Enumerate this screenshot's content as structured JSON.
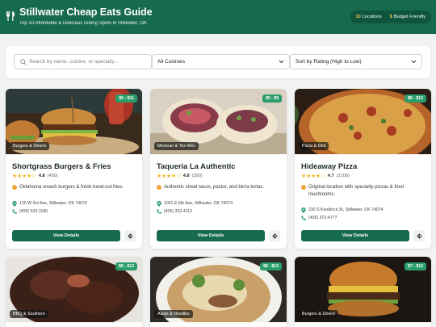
{
  "header": {
    "title": "Stillwater Cheap Eats Guide",
    "subtitle": "Top 10 Affordable & Delicious Dining Spots in Stillwater, OK",
    "stats": [
      {
        "value": "10",
        "label": "Locations"
      },
      {
        "value": "$",
        "label": "Budget Friendly"
      }
    ]
  },
  "filters": {
    "search_placeholder": "Search by name, cuisine, or specialty...",
    "cuisine_selected": "All Cuisines",
    "sort_selected": "Sort by Rating (High to Low)"
  },
  "restaurants": [
    {
      "name": "Shortgrass Burgers & Fries",
      "price": "$6 - $11",
      "category": "Burgers & Diners",
      "stars": "★★★★☆",
      "rating": "4.8",
      "reviews": "(450)",
      "specialty": "Oklahoma smash burgers & fresh hand-cut fries.",
      "address": "120 W 3rd Ave, Stillwater, OK 74074",
      "phone": "(405) 533-1180",
      "button": "View Details"
    },
    {
      "name": "Taqueria La Authentic",
      "price": "$5 - $9",
      "category": "Mexican & Tex-Mex",
      "stars": "★★★★☆",
      "rating": "4.8",
      "reviews": "(390)",
      "specialty": "Authentic street tacos, pastor, and birria tortas.",
      "address": "1001 E 6th Ave, Stillwater, OK 74074",
      "phone": "(405) 332-4112",
      "button": "View Details"
    },
    {
      "name": "Hideaway Pizza",
      "price": "$8 - $13",
      "category": "Pizza & Deli",
      "stars": "★★★★☆",
      "rating": "4.7",
      "reviews": "(2100)",
      "specialty": "Original location with specialty pizzas & fried mushrooms.",
      "address": "230 S Knoblock St, Stillwater, OK 74074",
      "phone": "(405) 372-4777",
      "button": "View Details"
    },
    {
      "price": "$8 - $13",
      "category": "BBQ & Southern"
    },
    {
      "price": "$8 - $12",
      "category": "Asian & Noodles"
    },
    {
      "price": "$7 - $12",
      "category": "Burgers & Diners"
    }
  ],
  "colors": {
    "brand": "#166a4d",
    "price_badge": "#2a9d6b",
    "star": "#f2b824"
  }
}
